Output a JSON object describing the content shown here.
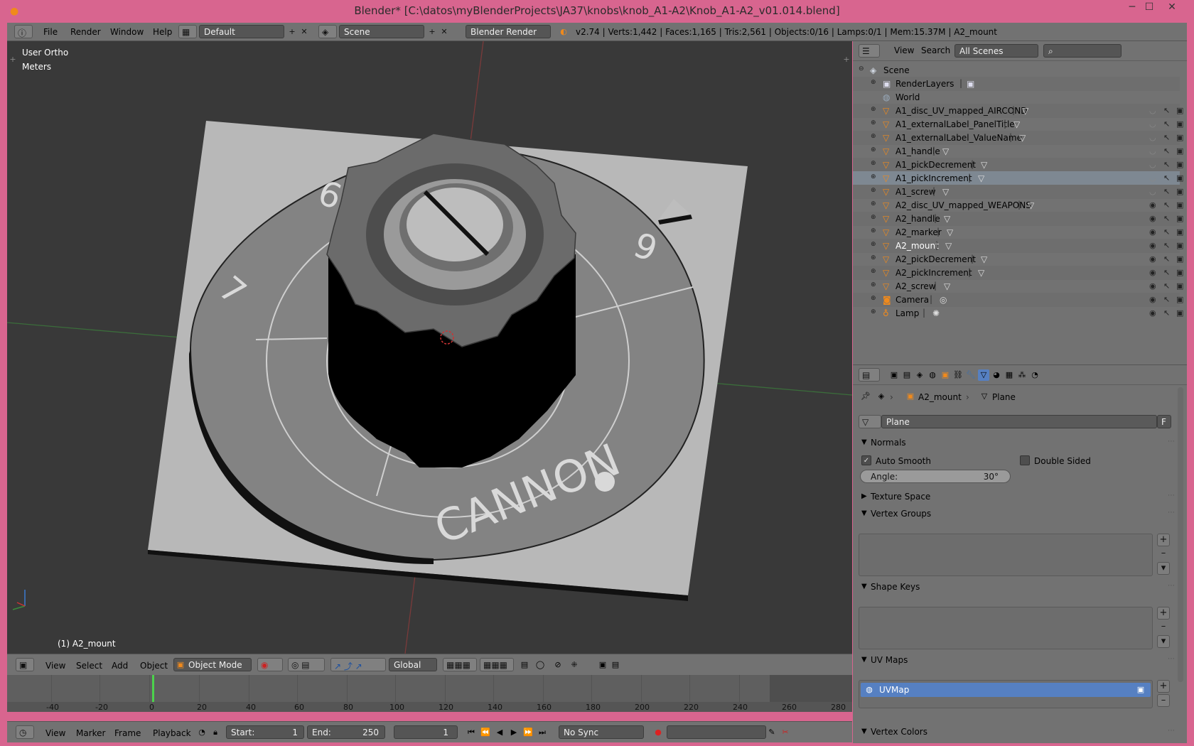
{
  "window": {
    "title": "Blender* [C:\\datos\\myBlenderProjects\\JA37\\knobs\\knob_A1-A2\\Knob_A1-A2_v01.014.blend]",
    "min": "─",
    "max": "☐",
    "close": "✕"
  },
  "infobar": {
    "menus": [
      "File",
      "Render",
      "Window",
      "Help"
    ],
    "layout": "Default",
    "scene": "Scene",
    "engine": "Blender Render",
    "stats": "v2.74 | Verts:1,442 | Faces:1,165 | Tris:2,561 | Objects:0/16 | Lamps:0/1 | Mem:15.37M | A2_mount"
  },
  "viewport": {
    "view_name": "User Ortho",
    "units": "Meters",
    "object_label": "(1) A2_mount",
    "knob_labels": [
      "CANNON",
      "6",
      "7",
      "9"
    ]
  },
  "view3d_header": {
    "menus": [
      "View",
      "Select",
      "Add",
      "Object"
    ],
    "mode": "Object Mode",
    "orientation": "Global"
  },
  "timeline": {
    "ruler": [
      "-40",
      "-20",
      "0",
      "20",
      "40",
      "60",
      "80",
      "100",
      "120",
      "140",
      "160",
      "180",
      "200",
      "220",
      "240",
      "260",
      "280"
    ],
    "menus": [
      "View",
      "Marker",
      "Frame",
      "Playback"
    ],
    "start_label": "Start:",
    "start": "1",
    "end_label": "End:",
    "end": "250",
    "current": "1",
    "sync": "No Sync"
  },
  "outliner": {
    "menus": [
      "View",
      "Search"
    ],
    "filter": "All Scenes",
    "items": [
      {
        "name": "Scene",
        "kind": "scene"
      },
      {
        "name": "RenderLayers",
        "kind": "renderlayers"
      },
      {
        "name": "World",
        "kind": "world"
      },
      {
        "name": "A1_disc_UV_mapped_AIRCOND",
        "kind": "mesh"
      },
      {
        "name": "A1_externalLabel_PanelTitle",
        "kind": "mesh"
      },
      {
        "name": "A1_externalLabel_ValueName",
        "kind": "mesh"
      },
      {
        "name": "A1_handle",
        "kind": "mesh"
      },
      {
        "name": "A1_pickDecrement",
        "kind": "mesh"
      },
      {
        "name": "A1_pickIncrement",
        "kind": "mesh"
      },
      {
        "name": "A1_screw",
        "kind": "mesh"
      },
      {
        "name": "A2_disc_UV_mapped_WEAPONS",
        "kind": "mesh"
      },
      {
        "name": "A2_handle",
        "kind": "mesh"
      },
      {
        "name": "A2_marker",
        "kind": "mesh"
      },
      {
        "name": "A2_mount",
        "kind": "mesh"
      },
      {
        "name": "A2_pickDecrement",
        "kind": "mesh"
      },
      {
        "name": "A2_pickIncrement",
        "kind": "mesh"
      },
      {
        "name": "A2_screw",
        "kind": "mesh"
      },
      {
        "name": "Camera",
        "kind": "camera"
      },
      {
        "name": "Lamp",
        "kind": "lamp"
      }
    ]
  },
  "properties": {
    "breadcrumb_object": "A2_mount",
    "breadcrumb_data": "Plane",
    "datablock": "Plane",
    "fake_user": "F",
    "sections": {
      "normals": "Normals",
      "texture_space": "Texture Space",
      "vertex_groups": "Vertex Groups",
      "shape_keys": "Shape Keys",
      "uv_maps": "UV Maps",
      "vertex_colors": "Vertex Colors"
    },
    "auto_smooth": "Auto Smooth",
    "double_sided": "Double Sided",
    "angle_label": "Angle:",
    "angle_value": "30°",
    "uv_map": "UVMap"
  },
  "colors": {
    "window_frame": "#d8658f",
    "panel": "#727272",
    "viewport_bg": "#393939",
    "accent_selected": "#5680c2",
    "mesh_icon": "#f08a1c"
  }
}
